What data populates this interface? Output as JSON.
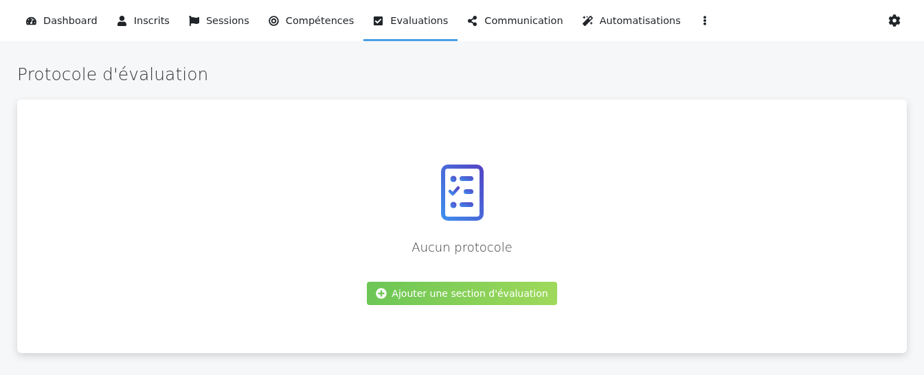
{
  "tabs": [
    {
      "label": "Dashboard",
      "selected": false
    },
    {
      "label": "Inscrits",
      "selected": false
    },
    {
      "label": "Sessions",
      "selected": false
    },
    {
      "label": "Compétences",
      "selected": false
    },
    {
      "label": "Evaluations",
      "selected": true
    },
    {
      "label": "Communication",
      "selected": false
    },
    {
      "label": "Automatisations",
      "selected": false
    }
  ],
  "page_title": "Protocole d'évaluation",
  "empty_state": {
    "message": "Aucun protocole",
    "button": "Ajouter une section d'évaluation"
  }
}
